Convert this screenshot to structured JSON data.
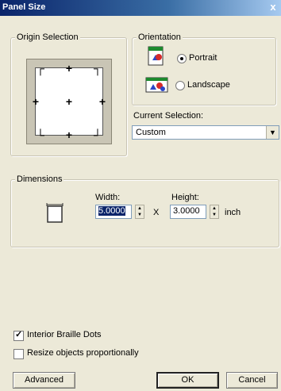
{
  "title": "Panel Size",
  "close_glyph": "x",
  "origin": {
    "legend": "Origin Selection"
  },
  "orientation": {
    "legend": "Orientation",
    "portrait_label": "Portrait",
    "landscape_label": "Landscape",
    "selected": "portrait"
  },
  "current_selection": {
    "label": "Current Selection:",
    "value": "Custom"
  },
  "dimensions": {
    "legend": "Dimensions",
    "width_label": "Width:",
    "height_label": "Height:",
    "width_value": "5.0000",
    "height_value": "3.0000",
    "separator": "X",
    "unit": "inch"
  },
  "options": {
    "interior_braille_label": "Interior Braille Dots",
    "interior_braille_checked": true,
    "resize_label": "Resize objects proportionally",
    "resize_checked": false
  },
  "buttons": {
    "advanced": "Advanced",
    "ok": "OK",
    "cancel": "Cancel"
  }
}
